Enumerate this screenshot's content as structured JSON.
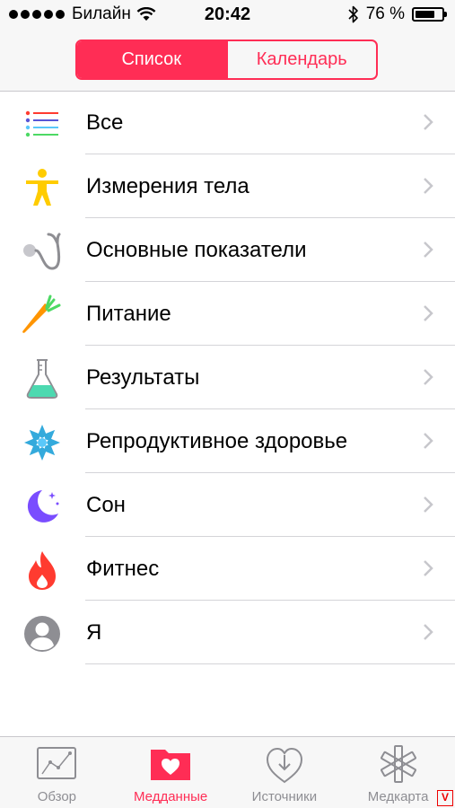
{
  "status_bar": {
    "carrier": "Билайн",
    "time": "20:42",
    "battery_percent": "76 %",
    "battery_level": 0.76
  },
  "segmented": {
    "list_label": "Список",
    "calendar_label": "Календарь",
    "selected": "list"
  },
  "categories": [
    {
      "label": "Все",
      "icon": "list-icon"
    },
    {
      "label": "Измерения тела",
      "icon": "body-figure-icon"
    },
    {
      "label": "Основные показатели",
      "icon": "stethoscope-icon"
    },
    {
      "label": "Питание",
      "icon": "carrot-icon"
    },
    {
      "label": "Результаты",
      "icon": "flask-icon"
    },
    {
      "label": "Репродуктивное здоровье",
      "icon": "flower-icon"
    },
    {
      "label": "Сон",
      "icon": "moon-icon"
    },
    {
      "label": "Фитнес",
      "icon": "flame-icon"
    },
    {
      "label": "Я",
      "icon": "person-icon"
    }
  ],
  "tabbar": {
    "items": [
      {
        "label": "Обзор",
        "icon": "dashboard-icon",
        "active": false
      },
      {
        "label": "Медданные",
        "icon": "folder-heart-icon",
        "active": true
      },
      {
        "label": "Источники",
        "icon": "download-heart-icon",
        "active": false
      },
      {
        "label": "Медкарта",
        "icon": "medical-star-icon",
        "active": false
      }
    ]
  },
  "colors": {
    "accent": "#ff2d55",
    "inactive": "#8e8e93"
  }
}
